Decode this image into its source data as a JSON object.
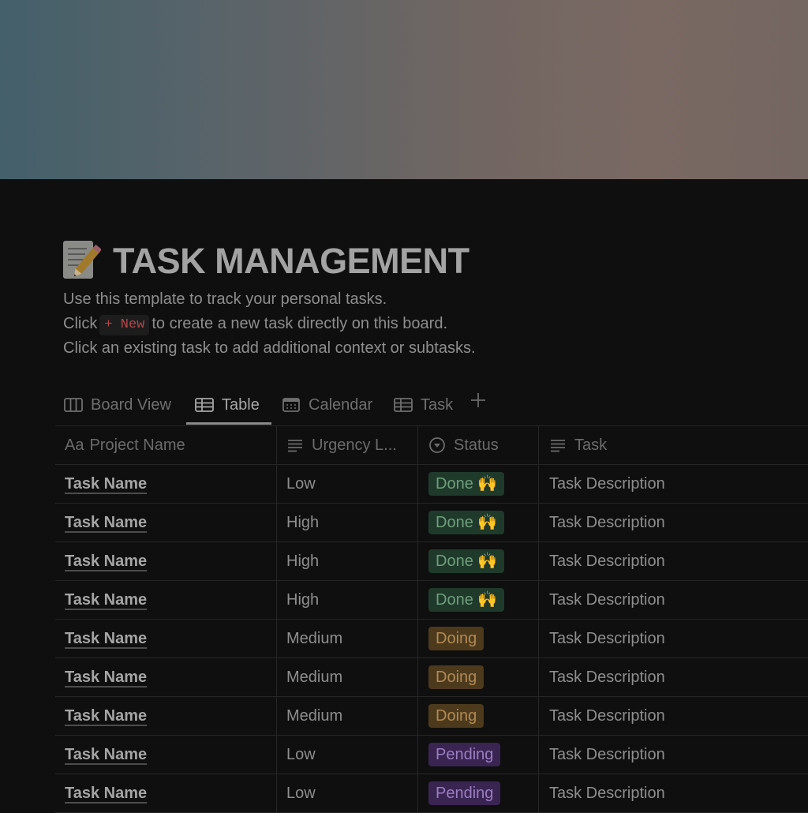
{
  "page": {
    "icon": "memo-pencil-icon",
    "title": "TASK MANAGEMENT",
    "description": {
      "line1": "Use this template to track your personal tasks.",
      "line2_prefix": "Click",
      "new_button_label": "+ New",
      "line2_suffix": "to create a new task directly on this board.",
      "line3": "Click an existing task to add additional context or subtasks."
    }
  },
  "views": {
    "tabs": [
      {
        "label": "Board View",
        "icon": "board-icon",
        "active": false
      },
      {
        "label": "Table",
        "icon": "table-icon",
        "active": true
      },
      {
        "label": "Calendar",
        "icon": "calendar-icon",
        "active": false
      },
      {
        "label": "Task",
        "icon": "table-icon",
        "active": false
      }
    ],
    "add_icon": "plus-icon"
  },
  "table": {
    "columns": [
      {
        "label": "Project Name",
        "icon": "title-property-icon",
        "icon_text": "Aa"
      },
      {
        "label": "Urgency L...",
        "icon": "text-lines-icon"
      },
      {
        "label": "Status",
        "icon": "status-icon"
      },
      {
        "label": "Task",
        "icon": "text-lines-icon"
      }
    ],
    "status_colors": {
      "Done": {
        "bg": "#1f3a2b",
        "fg": "#6f9e7c"
      },
      "Doing": {
        "bg": "#4d3a1c",
        "fg": "#b08a55"
      },
      "Pending": {
        "bg": "#3a2452",
        "fg": "#9a7fc0"
      }
    },
    "rows": [
      {
        "name": "Task Name",
        "urgency": "Low",
        "status": "Done",
        "status_label": "Done 🙌",
        "task": "Task Description"
      },
      {
        "name": "Task Name",
        "urgency": "High",
        "status": "Done",
        "status_label": "Done 🙌",
        "task": "Task Description"
      },
      {
        "name": "Task Name",
        "urgency": "High",
        "status": "Done",
        "status_label": "Done 🙌",
        "task": "Task Description"
      },
      {
        "name": "Task Name",
        "urgency": "High",
        "status": "Done",
        "status_label": "Done 🙌",
        "task": "Task Description"
      },
      {
        "name": "Task Name",
        "urgency": "Medium",
        "status": "Doing",
        "status_label": "Doing",
        "task": "Task Description"
      },
      {
        "name": "Task Name",
        "urgency": "Medium",
        "status": "Doing",
        "status_label": "Doing",
        "task": "Task Description"
      },
      {
        "name": "Task Name",
        "urgency": "Medium",
        "status": "Doing",
        "status_label": "Doing",
        "task": "Task Description"
      },
      {
        "name": "Task Name",
        "urgency": "Low",
        "status": "Pending",
        "status_label": "Pending",
        "task": "Task Description"
      },
      {
        "name": "Task Name",
        "urgency": "Low",
        "status": "Pending",
        "status_label": "Pending",
        "task": "Task Description"
      }
    ]
  }
}
